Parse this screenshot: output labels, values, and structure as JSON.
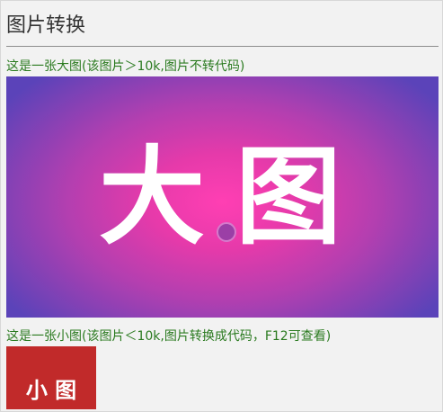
{
  "page": {
    "title": "图片转换"
  },
  "big_image": {
    "caption": "这是一张大图(该图片＞10k,图片不转代码)",
    "artwork_text": "大图",
    "colors": {
      "center": "#ff3fb3",
      "edge": "#5b43b9",
      "text": "#ffffff",
      "dot": "#9b3fa6"
    }
  },
  "small_image": {
    "caption": "这是一张小图(该图片＜10k,图片转换成代码，F12可查看)",
    "artwork_text": "小图",
    "colors": {
      "background": "#c12a2a",
      "text": "#ffffff"
    }
  }
}
